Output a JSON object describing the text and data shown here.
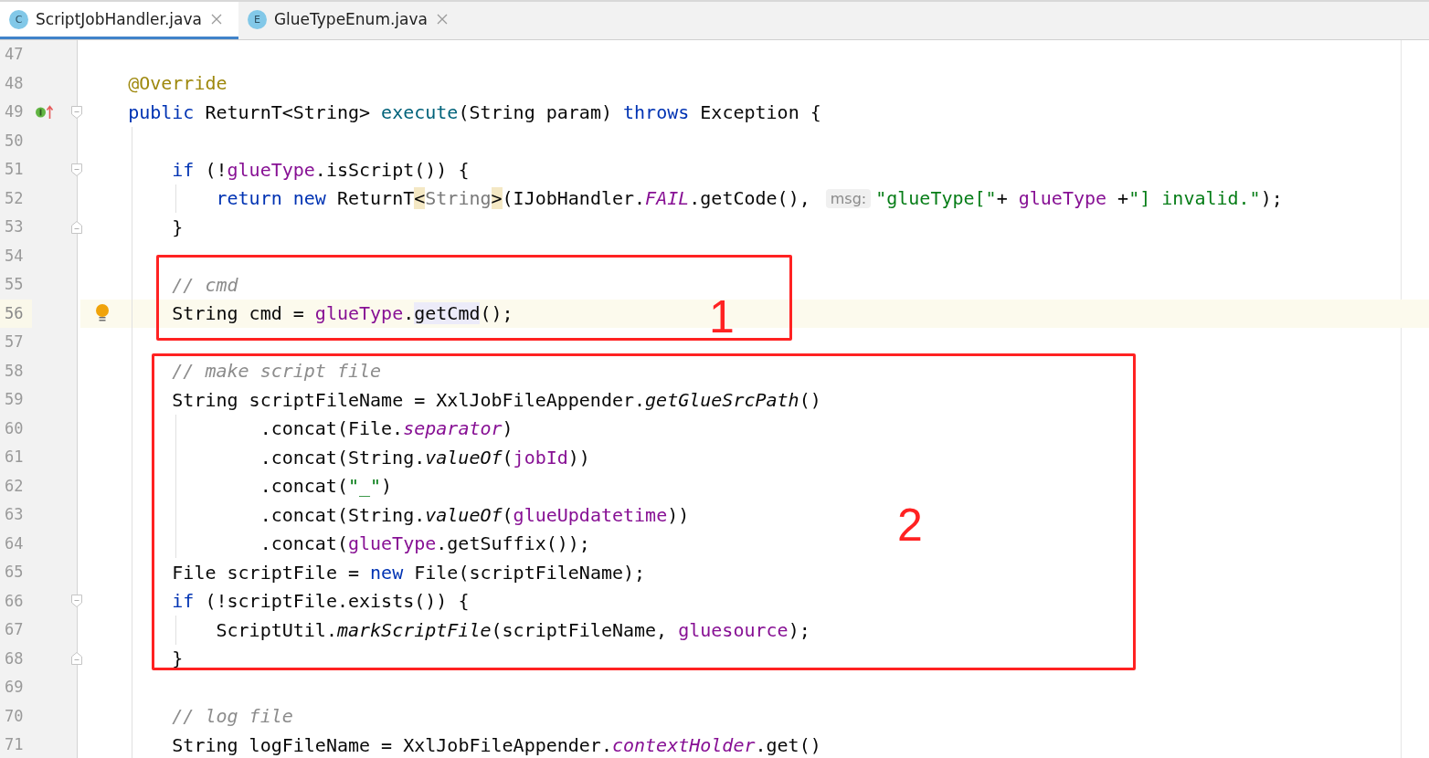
{
  "tabs": [
    {
      "icon_letter": "C",
      "label": "ScriptJobHandler.java",
      "selected": true
    },
    {
      "icon_letter": "E",
      "label": "GlueTypeEnum.java",
      "selected": false
    }
  ],
  "lines": [
    {
      "number": "47",
      "current": false
    },
    {
      "number": "48",
      "current": false,
      "tokens": [
        {
          "kind": "ann",
          "text": "    @Override"
        }
      ]
    },
    {
      "number": "49",
      "markers": [
        {
          "kind": "override"
        },
        {
          "kind": "fold-start"
        }
      ],
      "current": false,
      "tokens": [
        {
          "kind": "kw",
          "text": "    public"
        },
        {
          "kind": "plain",
          "text": " ReturnT<String> "
        },
        {
          "kind": "decl",
          "text": "execute"
        },
        {
          "kind": "plain",
          "text": "(String param) "
        },
        {
          "kind": "kw",
          "text": "throws"
        },
        {
          "kind": "plain",
          "text": " Exception {"
        }
      ]
    },
    {
      "number": "50",
      "current": false
    },
    {
      "number": "51",
      "markers": [
        {
          "kind": "fold-start"
        }
      ],
      "current": false,
      "tokens": [
        {
          "kind": "kw",
          "text": "        if"
        },
        {
          "kind": "plain",
          "text": " (!"
        },
        {
          "kind": "field",
          "text": "glueType"
        },
        {
          "kind": "plain",
          "text": ".isScript()) {"
        }
      ]
    },
    {
      "number": "52",
      "current": false,
      "tokens": [
        {
          "kind": "kw",
          "text": "            return new"
        },
        {
          "kind": "plain",
          "text": " ReturnT"
        },
        {
          "kind": "match",
          "text": "<"
        },
        {
          "kind": "generic",
          "text": "String"
        },
        {
          "kind": "match",
          "text": ">"
        },
        {
          "kind": "plain",
          "text": "(IJobHandler."
        },
        {
          "kind": "static",
          "text": "FAIL"
        },
        {
          "kind": "plain",
          "text": ".getCode(),"
        },
        {
          "kind": "hint",
          "text": "msg:"
        },
        {
          "kind": "str",
          "text": "\"glueType[\""
        },
        {
          "kind": "plain",
          "text": "+ "
        },
        {
          "kind": "field",
          "text": "glueType"
        },
        {
          "kind": "plain",
          "text": " +"
        },
        {
          "kind": "str",
          "text": "\"] invalid.\""
        },
        {
          "kind": "plain",
          "text": ");"
        }
      ]
    },
    {
      "number": "53",
      "markers": [
        {
          "kind": "fold-end"
        }
      ],
      "current": false,
      "tokens": [
        {
          "kind": "plain",
          "text": "        }"
        }
      ]
    },
    {
      "number": "54",
      "current": false
    },
    {
      "number": "55",
      "current": false,
      "tokens": [
        {
          "kind": "comment",
          "text": "        // cmd"
        }
      ]
    },
    {
      "number": "56",
      "markers": [
        {
          "kind": "bulb"
        }
      ],
      "current": true,
      "tokens": [
        {
          "kind": "plain",
          "text": "        String cmd = "
        },
        {
          "kind": "field",
          "text": "glueType"
        },
        {
          "kind": "plain",
          "text": "."
        },
        {
          "kind": "usage",
          "text": "getCmd"
        },
        {
          "kind": "plain",
          "text": "();"
        }
      ]
    },
    {
      "number": "57",
      "current": false
    },
    {
      "number": "58",
      "current": false,
      "tokens": [
        {
          "kind": "comment",
          "text": "        // make script file"
        }
      ]
    },
    {
      "number": "59",
      "current": false,
      "tokens": [
        {
          "kind": "plain",
          "text": "        String scriptFileName = XxlJobFileAppender."
        },
        {
          "kind": "smethod",
          "text": "getGlueSrcPath"
        },
        {
          "kind": "plain",
          "text": "()"
        }
      ]
    },
    {
      "number": "60",
      "current": false,
      "tokens": [
        {
          "kind": "plain",
          "text": "                .concat(File."
        },
        {
          "kind": "static",
          "text": "separator"
        },
        {
          "kind": "plain",
          "text": ")"
        }
      ]
    },
    {
      "number": "61",
      "current": false,
      "tokens": [
        {
          "kind": "plain",
          "text": "                .concat(String."
        },
        {
          "kind": "smethod",
          "text": "valueOf"
        },
        {
          "kind": "plain",
          "text": "("
        },
        {
          "kind": "field",
          "text": "jobId"
        },
        {
          "kind": "plain",
          "text": "))"
        }
      ]
    },
    {
      "number": "62",
      "current": false,
      "tokens": [
        {
          "kind": "plain",
          "text": "                .concat("
        },
        {
          "kind": "str",
          "text": "\"_\""
        },
        {
          "kind": "plain",
          "text": ")"
        }
      ]
    },
    {
      "number": "63",
      "current": false,
      "tokens": [
        {
          "kind": "plain",
          "text": "                .concat(String."
        },
        {
          "kind": "smethod",
          "text": "valueOf"
        },
        {
          "kind": "plain",
          "text": "("
        },
        {
          "kind": "field",
          "text": "glueUpdatetime"
        },
        {
          "kind": "plain",
          "text": "))"
        }
      ]
    },
    {
      "number": "64",
      "current": false,
      "tokens": [
        {
          "kind": "plain",
          "text": "                .concat("
        },
        {
          "kind": "field",
          "text": "glueType"
        },
        {
          "kind": "plain",
          "text": ".getSuffix());"
        }
      ]
    },
    {
      "number": "65",
      "current": false,
      "tokens": [
        {
          "kind": "plain",
          "text": "        File scriptFile = "
        },
        {
          "kind": "kw",
          "text": "new"
        },
        {
          "kind": "plain",
          "text": " File(scriptFileName);"
        }
      ]
    },
    {
      "number": "66",
      "markers": [
        {
          "kind": "fold-start"
        }
      ],
      "current": false,
      "tokens": [
        {
          "kind": "kw",
          "text": "        if"
        },
        {
          "kind": "plain",
          "text": " (!scriptFile.exists()) {"
        }
      ]
    },
    {
      "number": "67",
      "current": false,
      "tokens": [
        {
          "kind": "plain",
          "text": "            ScriptUtil."
        },
        {
          "kind": "smethod",
          "text": "markScriptFile"
        },
        {
          "kind": "plain",
          "text": "(scriptFileName, "
        },
        {
          "kind": "field",
          "text": "gluesource"
        },
        {
          "kind": "plain",
          "text": ");"
        }
      ]
    },
    {
      "number": "68",
      "markers": [
        {
          "kind": "fold-end"
        }
      ],
      "current": false,
      "tokens": [
        {
          "kind": "plain",
          "text": "        }"
        }
      ]
    },
    {
      "number": "69",
      "current": false
    },
    {
      "number": "70",
      "current": false,
      "tokens": [
        {
          "kind": "comment",
          "text": "        // log file"
        }
      ]
    },
    {
      "number": "71",
      "current": false,
      "tokens": [
        {
          "kind": "plain",
          "text": "        String logFileName = XxlJobFileAppender."
        },
        {
          "kind": "static",
          "text": "contextHolder"
        },
        {
          "kind": "plain",
          "text": ".get()"
        }
      ]
    }
  ],
  "annotations": [
    {
      "label": "1"
    },
    {
      "label": "2"
    }
  ]
}
